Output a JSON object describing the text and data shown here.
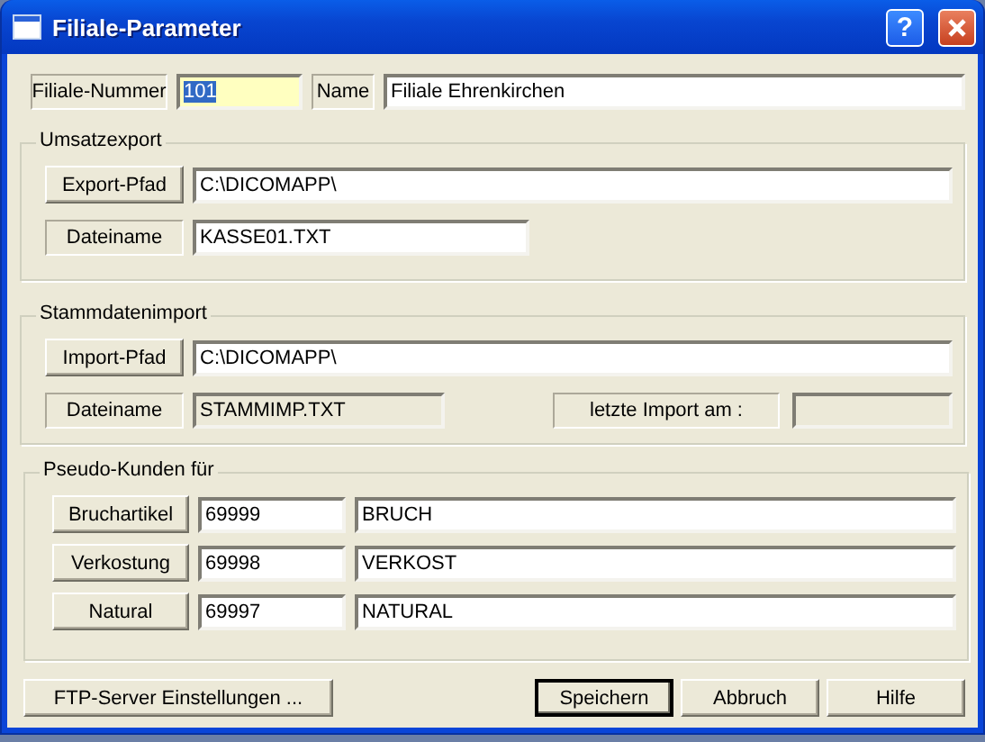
{
  "window": {
    "title": "Filiale-Parameter",
    "help_label": "?"
  },
  "branch": {
    "number_label": "Filiale-Nummer",
    "number": "101",
    "number_selected": true,
    "name_label": "Name",
    "name": "Filiale Ehrenkirchen"
  },
  "sales_export": {
    "title": "Umsatzexport",
    "path_button": "Export-Pfad",
    "path": "C:\\DICOMAPP\\",
    "file_label": "Dateiname",
    "file": "KASSE01.TXT",
    "file_disabled": false
  },
  "master_import": {
    "title": "Stammdatenimport",
    "path_button": "Import-Pfad",
    "path": "C:\\DICOMAPP\\",
    "file_label": "Dateiname",
    "file": "STAMMIMP.TXT",
    "file_disabled": true,
    "last_import_label": "letzte Import am :",
    "last_import_disabled": true
  },
  "pseudo_customers": {
    "title": "Pseudo-Kunden für",
    "rows": [
      {
        "button": "Bruchartikel",
        "number": "69999",
        "name": "BRUCH"
      },
      {
        "button": "Verkostung",
        "number": "69998",
        "name": "VERKOST"
      },
      {
        "button": "Natural",
        "number": "69997",
        "name": "NATURAL"
      }
    ]
  },
  "buttons": [
    {
      "label": "FTP-Server Einstellungen ...",
      "default": false
    },
    {
      "label": "Speichern",
      "default": true
    },
    {
      "label": "Abbruch",
      "default": false
    },
    {
      "label": "Hilfe",
      "default": false
    }
  ]
}
